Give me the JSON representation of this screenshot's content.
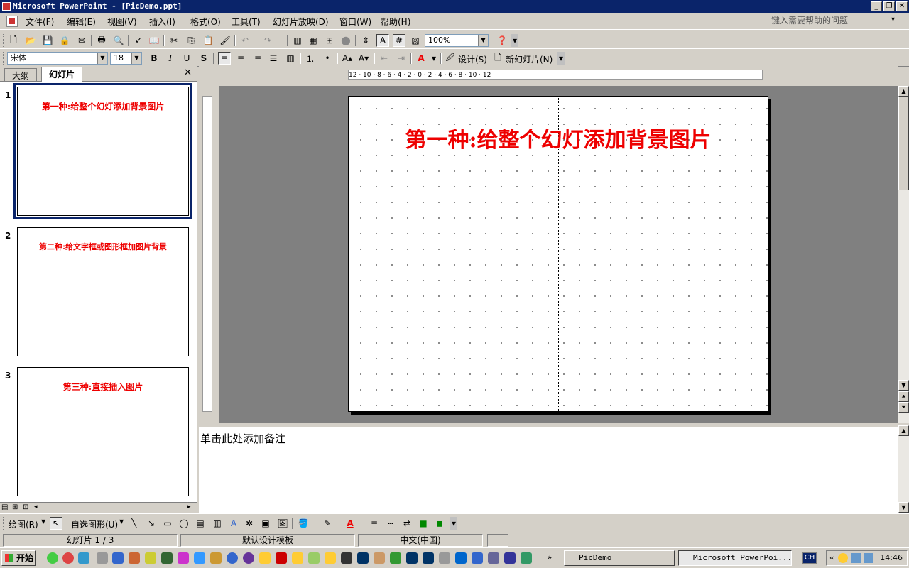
{
  "window": {
    "title": "Microsoft PowerPoint - [PicDemo.ppt]"
  },
  "menu": {
    "items": [
      "文件(F)",
      "编辑(E)",
      "视图(V)",
      "插入(I)",
      "格式(O)",
      "工具(T)",
      "幻灯片放映(D)",
      "窗口(W)",
      "帮助(H)"
    ],
    "help_placeholder": "键入需要帮助的问题"
  },
  "standard_toolbar": {
    "zoom": "100%"
  },
  "format_toolbar": {
    "font": "宋体",
    "size": "18",
    "design_label": "设计(S)",
    "new_slide_label": "新幻灯片(N)"
  },
  "left_pane": {
    "tabs": [
      "大纲",
      "幻灯片"
    ],
    "slides": [
      {
        "num": "1",
        "title": "第一种:给整个幻灯添加背景图片"
      },
      {
        "num": "2",
        "title": "第二种:给文字框或图形框加图片背景"
      },
      {
        "num": "3",
        "title": "第三种:直接插入图片"
      }
    ]
  },
  "ruler": {
    "horizontal": "12 · 10 · 8 · 6 · 4 · 2 · 0 · 2 · 4 · 6 · 8 · 10 · 12"
  },
  "slide": {
    "title": "第一种:给整个幻灯添加背景图片"
  },
  "notes": {
    "placeholder": "单击此处添加备注"
  },
  "draw_toolbar": {
    "draw_label": "绘图(R)",
    "autoshapes_label": "自选图形(U)"
  },
  "status": {
    "slide": "幻灯片 1 / 3",
    "template": "默认设计模板",
    "language": "中文(中国)"
  },
  "taskbar": {
    "start": "开始",
    "tasks": [
      "PicDemo",
      "Microsoft PowerPoi..."
    ],
    "ime": "CH",
    "time": "14:46"
  }
}
